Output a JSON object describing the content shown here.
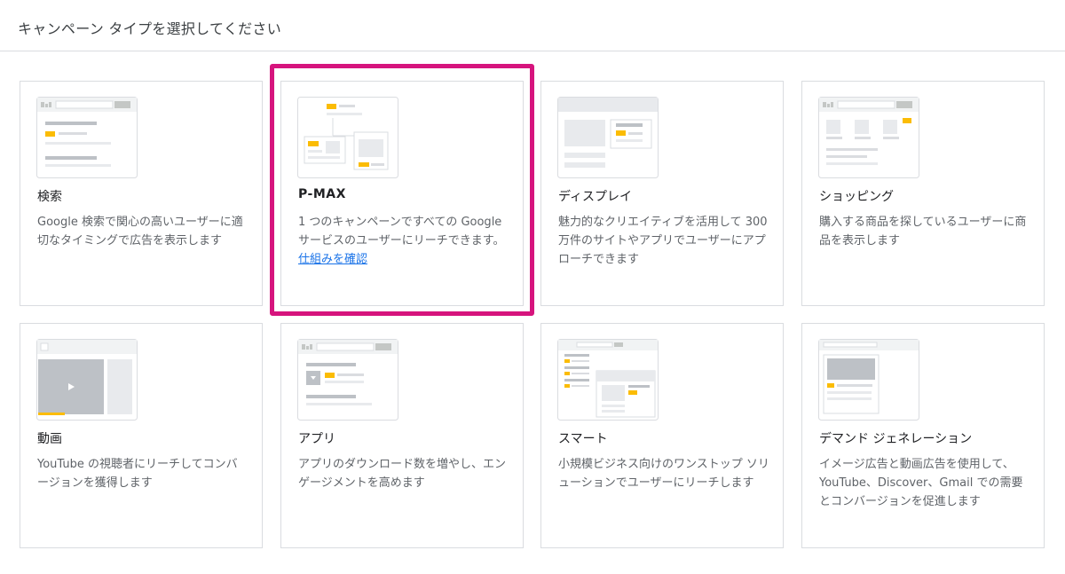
{
  "header": {
    "title": "キャンペーン タイプを選択してください"
  },
  "cards": [
    {
      "title": "検索",
      "desc": "Google 検索で関心の高いユーザーに適切なタイミングで広告を表示します"
    },
    {
      "title": "P-MAX",
      "desc": "1 つのキャンペーンですべての Google サービスのユーザーにリーチできます。",
      "link": "仕組みを確認"
    },
    {
      "title": "ディスプレイ",
      "desc": "魅力的なクリエイティブを活用して 300 万件のサイトやアプリでユーザーにアプローチできます"
    },
    {
      "title": "ショッピング",
      "desc": "購入する商品を探しているユーザーに商品を表示します"
    },
    {
      "title": "動画",
      "desc": "YouTube の視聴者にリーチしてコンバージョンを獲得します"
    },
    {
      "title": "アプリ",
      "desc": "アプリのダウンロード数を増やし、エンゲージメントを高めます"
    },
    {
      "title": "スマート",
      "desc": "小規模ビジネス向けのワンストップ ソリューションでユーザーにリーチします"
    },
    {
      "title": "デマンド ジェネレーション",
      "desc": "イメージ広告と動画広告を使用して、YouTube、Discover、Gmail での需要とコンバージョンを促進します"
    }
  ],
  "colors": {
    "accent_yellow": "#fbbc04",
    "highlight": "#d6147d",
    "link": "#1a73e8"
  },
  "selected_card": "P-MAX"
}
